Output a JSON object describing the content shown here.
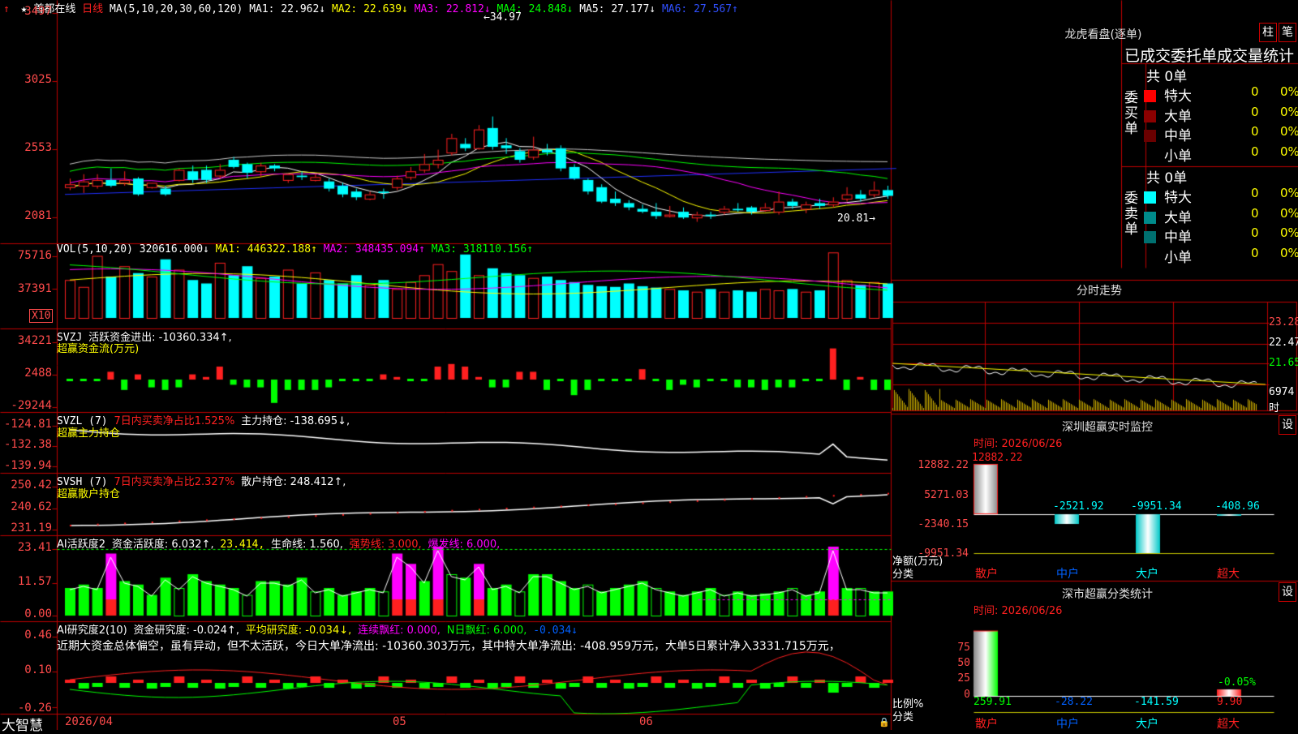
{
  "colors": {
    "up": "#ff2020",
    "down": "#00ffff",
    "grid": "#c00000",
    "ma1": "#ffffff",
    "ma2": "#ffff00",
    "ma3": "#ff00ff",
    "ma4": "#00ff00",
    "ma5": "#ffffff",
    "ma6": "#0000ff"
  },
  "header": {
    "title": "首都在线",
    "period": "日线",
    "ma_params": "MA(5,10,20,30,60,120)",
    "ma1": "MA1: 22.962↓",
    "ma2": "MA2: 22.639↓",
    "ma3": "MA3: 22.812↓",
    "ma4": "MA4: 24.848↓",
    "ma5": "MA5: 27.177↓",
    "ma6": "MA6: 27.567↑",
    "high_mark": "34.97",
    "low_mark": "20.81"
  },
  "price_axis": [
    "3497",
    "3025",
    "2553",
    "2081"
  ],
  "vol": {
    "label": "VOL(5,10,20)",
    "v": "320616.000↓",
    "ma1": "MA1: 446322.188↑",
    "ma2": "MA2: 348435.094↑",
    "ma3": "MA3: 318110.156↑",
    "axis": [
      "75716",
      "37391"
    ],
    "unit": "X10"
  },
  "svzj": {
    "label": "SVZJ",
    "text": "活跃资金进出: -10360.334↑,",
    "sub": "超赢资金流(万元)",
    "axis": [
      "34221",
      "2488",
      "-29244"
    ]
  },
  "svzl": {
    "label": "SVZL (7)",
    "ratio": "7日内买卖净占比1.525%",
    "hold": "主力持仓: -138.695↓,",
    "sub": "超赢主力持仓",
    "axis": [
      "-124.81",
      "-132.38",
      "-139.94"
    ]
  },
  "svsh": {
    "label": "SVSH (7)",
    "ratio": "7日内买卖净占比2.327%",
    "hold": "散户持仓: 248.412↑,",
    "sub": "超赢散户持仓",
    "axis": [
      "250.42",
      "240.62",
      "231.19"
    ]
  },
  "ai1": {
    "label": "AI活跃度2",
    "a": "资金活跃度: 6.032↑,",
    "b": "23.414,",
    "c": "生命线: 1.560,",
    "d": "强势线: 3.000,",
    "e": "爆发线: 6.000,",
    "axis": [
      "23.41",
      "11.57",
      "0.00"
    ]
  },
  "ai2": {
    "label": "AI研究度2(10)",
    "a": "资金研究度: -0.024↑,",
    "b": "平均研究度: -0.034↓,",
    "c": "连续飘红: 0.000,",
    "d": "N日飘红: 6.000,",
    "e": "-0.034↓",
    "comment": "近期大资金总体偏空，虽有异动，但不太活跃，今日大单净流出: -10360.303万元，其中特大单净流出: -408.959万元，大单5日累计净入3331.715万元，",
    "axis": [
      "0.46",
      "0.10",
      "-0.26"
    ]
  },
  "footer": {
    "brand": "大智慧",
    "date1": "2026/04",
    "date2": "05",
    "date3": "06"
  },
  "chart_data": {
    "type": "candlestick",
    "title": "首都在线",
    "series_labels": [
      "MA1",
      "MA2",
      "MA3",
      "MA4",
      "MA5",
      "MA6"
    ],
    "ylim": [
      20.81,
      34.97
    ],
    "candles": [
      {
        "o": 23.1,
        "c": 22.9,
        "h": 23.5,
        "l": 22.7,
        "up": true
      },
      {
        "o": 23.0,
        "c": 23.3,
        "h": 23.8,
        "l": 22.5,
        "up": true
      },
      {
        "o": 23.0,
        "c": 23.4,
        "h": 23.8,
        "l": 22.8,
        "up": true
      },
      {
        "o": 23.4,
        "c": 23.0,
        "h": 24.2,
        "l": 22.9,
        "up": false
      },
      {
        "o": 23.4,
        "c": 23.2,
        "h": 24.0,
        "l": 23.0,
        "up": true
      },
      {
        "o": 23.5,
        "c": 22.4,
        "h": 23.6,
        "l": 22.3,
        "up": false
      },
      {
        "o": 22.9,
        "c": 23.2,
        "h": 23.2,
        "l": 22.8,
        "up": true
      },
      {
        "o": 22.8,
        "c": 22.4,
        "h": 23.0,
        "l": 22.3,
        "up": false
      },
      {
        "o": 23.4,
        "c": 24.1,
        "h": 24.2,
        "l": 23.3,
        "up": true
      },
      {
        "o": 24.0,
        "c": 23.4,
        "h": 24.4,
        "l": 23.2,
        "up": false
      },
      {
        "o": 24.1,
        "c": 23.4,
        "h": 24.4,
        "l": 23.2,
        "up": false
      },
      {
        "o": 23.7,
        "c": 24.1,
        "h": 24.5,
        "l": 23.5,
        "up": true
      },
      {
        "o": 24.3,
        "c": 24.8,
        "h": 25.0,
        "l": 24.2,
        "up": false
      },
      {
        "o": 24.5,
        "c": 23.9,
        "h": 24.6,
        "l": 23.5,
        "up": false
      },
      {
        "o": 24.0,
        "c": 24.4,
        "h": 24.6,
        "l": 23.6,
        "up": true
      },
      {
        "o": 24.4,
        "c": 24.2,
        "h": 24.5,
        "l": 24.0,
        "up": false
      },
      {
        "o": 23.4,
        "c": 23.8,
        "h": 23.8,
        "l": 23.2,
        "up": true
      },
      {
        "o": 23.7,
        "c": 23.6,
        "h": 24.0,
        "l": 23.4,
        "up": false
      },
      {
        "o": 23.6,
        "c": 23.4,
        "h": 23.8,
        "l": 23.3,
        "up": true
      },
      {
        "o": 23.3,
        "c": 22.8,
        "h": 23.5,
        "l": 22.6,
        "up": false
      },
      {
        "o": 23.0,
        "c": 22.4,
        "h": 23.2,
        "l": 22.2,
        "up": false
      },
      {
        "o": 22.6,
        "c": 22.2,
        "h": 22.8,
        "l": 22.0,
        "up": false
      },
      {
        "o": 22.1,
        "c": 22.4,
        "h": 22.6,
        "l": 22.0,
        "up": true
      },
      {
        "o": 22.6,
        "c": 22.5,
        "h": 22.8,
        "l": 22.1,
        "up": false
      },
      {
        "o": 22.9,
        "c": 23.5,
        "h": 23.7,
        "l": 22.7,
        "up": true
      },
      {
        "o": 23.6,
        "c": 24.0,
        "h": 24.3,
        "l": 23.4,
        "up": true
      },
      {
        "o": 24.1,
        "c": 24.5,
        "h": 25.2,
        "l": 23.9,
        "up": true
      },
      {
        "o": 24.5,
        "c": 24.8,
        "h": 25.5,
        "l": 24.2,
        "up": true
      },
      {
        "o": 25.3,
        "c": 26.3,
        "h": 26.6,
        "l": 25.1,
        "up": true
      },
      {
        "o": 25.9,
        "c": 25.6,
        "h": 26.3,
        "l": 25.4,
        "up": false
      },
      {
        "o": 25.6,
        "c": 26.9,
        "h": 27.2,
        "l": 25.5,
        "up": true
      },
      {
        "o": 27.0,
        "c": 25.7,
        "h": 27.8,
        "l": 25.5,
        "up": false
      },
      {
        "o": 25.8,
        "c": 25.6,
        "h": 26.3,
        "l": 25.2,
        "up": false
      },
      {
        "o": 25.4,
        "c": 24.8,
        "h": 25.6,
        "l": 24.6,
        "up": false
      },
      {
        "o": 25.0,
        "c": 25.5,
        "h": 26.4,
        "l": 24.8,
        "up": true
      },
      {
        "o": 25.3,
        "c": 25.5,
        "h": 25.9,
        "l": 25.1,
        "up": false
      },
      {
        "o": 25.6,
        "c": 24.2,
        "h": 25.8,
        "l": 24.0,
        "up": false
      },
      {
        "o": 24.3,
        "c": 23.5,
        "h": 24.5,
        "l": 23.4,
        "up": false
      },
      {
        "o": 23.4,
        "c": 22.6,
        "h": 23.5,
        "l": 22.4,
        "up": false
      },
      {
        "o": 22.9,
        "c": 21.9,
        "h": 23.1,
        "l": 21.8,
        "up": false
      },
      {
        "o": 22.1,
        "c": 21.8,
        "h": 22.6,
        "l": 21.6,
        "up": false
      },
      {
        "o": 21.8,
        "c": 21.5,
        "h": 22.0,
        "l": 21.3,
        "up": false
      },
      {
        "o": 21.4,
        "c": 21.2,
        "h": 21.7,
        "l": 21.1,
        "up": false
      },
      {
        "o": 21.2,
        "c": 20.9,
        "h": 21.8,
        "l": 20.7,
        "up": false
      },
      {
        "o": 21.0,
        "c": 20.9,
        "h": 21.6,
        "l": 20.8,
        "up": true
      },
      {
        "o": 21.2,
        "c": 20.8,
        "h": 21.5,
        "l": 20.7,
        "up": false
      },
      {
        "o": 20.8,
        "c": 21.0,
        "h": 21.2,
        "l": 20.5,
        "up": true
      },
      {
        "o": 21.0,
        "c": 20.9,
        "h": 21.2,
        "l": 20.7,
        "up": false
      },
      {
        "o": 21.2,
        "c": 21.4,
        "h": 21.6,
        "l": 21.0,
        "up": true
      },
      {
        "o": 21.4,
        "c": 21.3,
        "h": 21.8,
        "l": 21.2,
        "up": false
      },
      {
        "o": 21.5,
        "c": 21.2,
        "h": 21.6,
        "l": 21.0,
        "up": false
      },
      {
        "o": 21.3,
        "c": 21.5,
        "h": 21.8,
        "l": 21.2,
        "up": true
      },
      {
        "o": 21.2,
        "c": 21.9,
        "h": 22.6,
        "l": 21.0,
        "up": true
      },
      {
        "o": 21.9,
        "c": 21.6,
        "h": 22.1,
        "l": 21.4,
        "up": false
      },
      {
        "o": 21.4,
        "c": 21.7,
        "h": 21.9,
        "l": 21.1,
        "up": true
      },
      {
        "o": 21.8,
        "c": 21.6,
        "h": 22.1,
        "l": 21.4,
        "up": false
      },
      {
        "o": 21.7,
        "c": 21.9,
        "h": 22.2,
        "l": 21.5,
        "up": true
      },
      {
        "o": 22.1,
        "c": 22.4,
        "h": 22.9,
        "l": 21.9,
        "up": true
      },
      {
        "o": 22.4,
        "c": 22.1,
        "h": 22.7,
        "l": 21.9,
        "up": false
      },
      {
        "o": 22.4,
        "c": 22.7,
        "h": 23.3,
        "l": 22.2,
        "up": true
      },
      {
        "o": 22.7,
        "c": 22.3,
        "h": 23.0,
        "l": 22.1,
        "up": false
      }
    ]
  },
  "right": {
    "lhb": {
      "title": "龙虎看盘(逐单)",
      "btn1": "柱",
      "btn2": "笔",
      "subtitle": "已成交委托单成交量统计",
      "buy": {
        "label": "委买单",
        "total": "共 0单",
        "rows": [
          {
            "name": "特大",
            "v": "0",
            "p": "0%",
            "c": "#ff0000"
          },
          {
            "name": "大单",
            "v": "0",
            "p": "0%",
            "c": "#8b0000"
          },
          {
            "name": "中单",
            "v": "0",
            "p": "0%",
            "c": "#6a0000"
          },
          {
            "name": "小单",
            "v": "0",
            "p": "0%",
            "c": ""
          }
        ]
      },
      "sell": {
        "label": "委卖单",
        "total": "共 0单",
        "rows": [
          {
            "name": "特大",
            "v": "0",
            "p": "0%",
            "c": "#00ffff"
          },
          {
            "name": "大单",
            "v": "0",
            "p": "0%",
            "c": "#008b8b"
          },
          {
            "name": "中单",
            "v": "0",
            "p": "0%",
            "c": "#007070"
          },
          {
            "name": "小单",
            "v": "0",
            "p": "0%",
            "c": ""
          }
        ]
      }
    },
    "fs": {
      "title": "分时走势",
      "axis": [
        "23.28",
        "22.47",
        "21.65",
        "6974"
      ],
      "unit": "时"
    },
    "sz": {
      "title": "深圳超赢实时监控",
      "btn": "设",
      "date": "时间: 2026/06/26",
      "axis": [
        "12882.22",
        "5271.03",
        "-2340.15",
        "-9951.34"
      ],
      "vals": [
        "12882.22",
        "-2521.92",
        "-9951.34",
        "-408.96"
      ],
      "ylab1": "净额(万元)",
      "ylab2": "分类",
      "cats": [
        "散户",
        "中户",
        "大户",
        "超大"
      ]
    },
    "ss": {
      "title": "深市超赢分类统计",
      "btn": "设",
      "date": "时间: 2026/06/26",
      "axis": [
        "75",
        "50",
        "25",
        "0"
      ],
      "vals": [
        "259.91",
        "-28.22",
        "-141.59",
        "9.90"
      ],
      "extra": "-0.05%",
      "ylab1": "比例%",
      "ylab2": "分类",
      "cats": [
        "散户",
        "中户",
        "大户",
        "超大"
      ]
    }
  }
}
